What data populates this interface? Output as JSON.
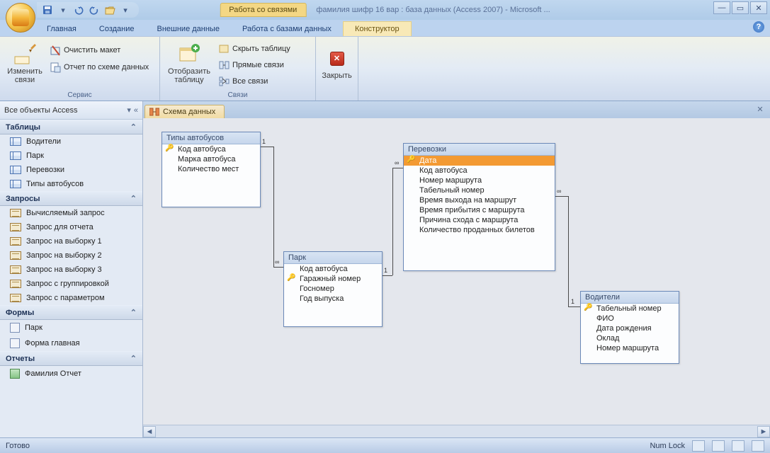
{
  "titlebar": {
    "context_title": "Работа со связями",
    "window_title": "фамилия шифр 16 вар : база данных (Access 2007) - Microsoft ..."
  },
  "tabs": {
    "home": "Главная",
    "create": "Создание",
    "external": "Внешние данные",
    "dbtools": "Работа с базами данных",
    "designer": "Конструктор"
  },
  "ribbon": {
    "edit_rel": "Изменить связи",
    "clear_layout": "Очистить макет",
    "schema_report": "Отчет по схеме данных",
    "group_service": "Сервис",
    "show_table": "Отобразить таблицу",
    "hide_table": "Скрыть таблицу",
    "direct_rel": "Прямые связи",
    "all_rel": "Все связи",
    "group_rel": "Связи",
    "close": "Закрыть"
  },
  "sidebar": {
    "title": "Все объекты Access",
    "cat_tables": "Таблицы",
    "tables": [
      "Водители",
      "Парк",
      "Перевозки",
      "Типы автобусов"
    ],
    "cat_queries": "Запросы",
    "queries": [
      "Вычисляемый запрос",
      "Запрос для отчета",
      "Запрос на выборку 1",
      "Запрос на выборку 2",
      "Запрос на выборку 3",
      "Запрос с группировкой",
      "Запрос с параметром"
    ],
    "cat_forms": "Формы",
    "forms": [
      "Парк",
      "Форма главная"
    ],
    "cat_reports": "Отчеты",
    "reports": [
      "Фамилия Отчет"
    ]
  },
  "doc": {
    "tab_title": "Схема данных"
  },
  "entities": {
    "bus_types": {
      "title": "Типы автобусов",
      "fields": [
        "Код автобуса",
        "Марка автобуса",
        "Количество мест"
      ]
    },
    "park": {
      "title": "Парк",
      "fields": [
        "Код автобуса",
        "Гаражный номер",
        "Госномер",
        "Год выпуска"
      ]
    },
    "transport": {
      "title": "Перевозки",
      "fields": [
        "Дата",
        "Код автобуса",
        "Номер маршрута",
        "Табельный номер",
        "Время выхода на маршрут",
        "Время прибытия с маршрута",
        "Причина схода с маршрута",
        "Количество проданных билетов"
      ]
    },
    "drivers": {
      "title": "Водители",
      "fields": [
        "Табельный номер",
        "ФИО",
        "Дата рождения",
        "Оклад",
        "Номер маршрута"
      ]
    }
  },
  "status": {
    "ready": "Готово",
    "numlock": "Num Lock"
  }
}
